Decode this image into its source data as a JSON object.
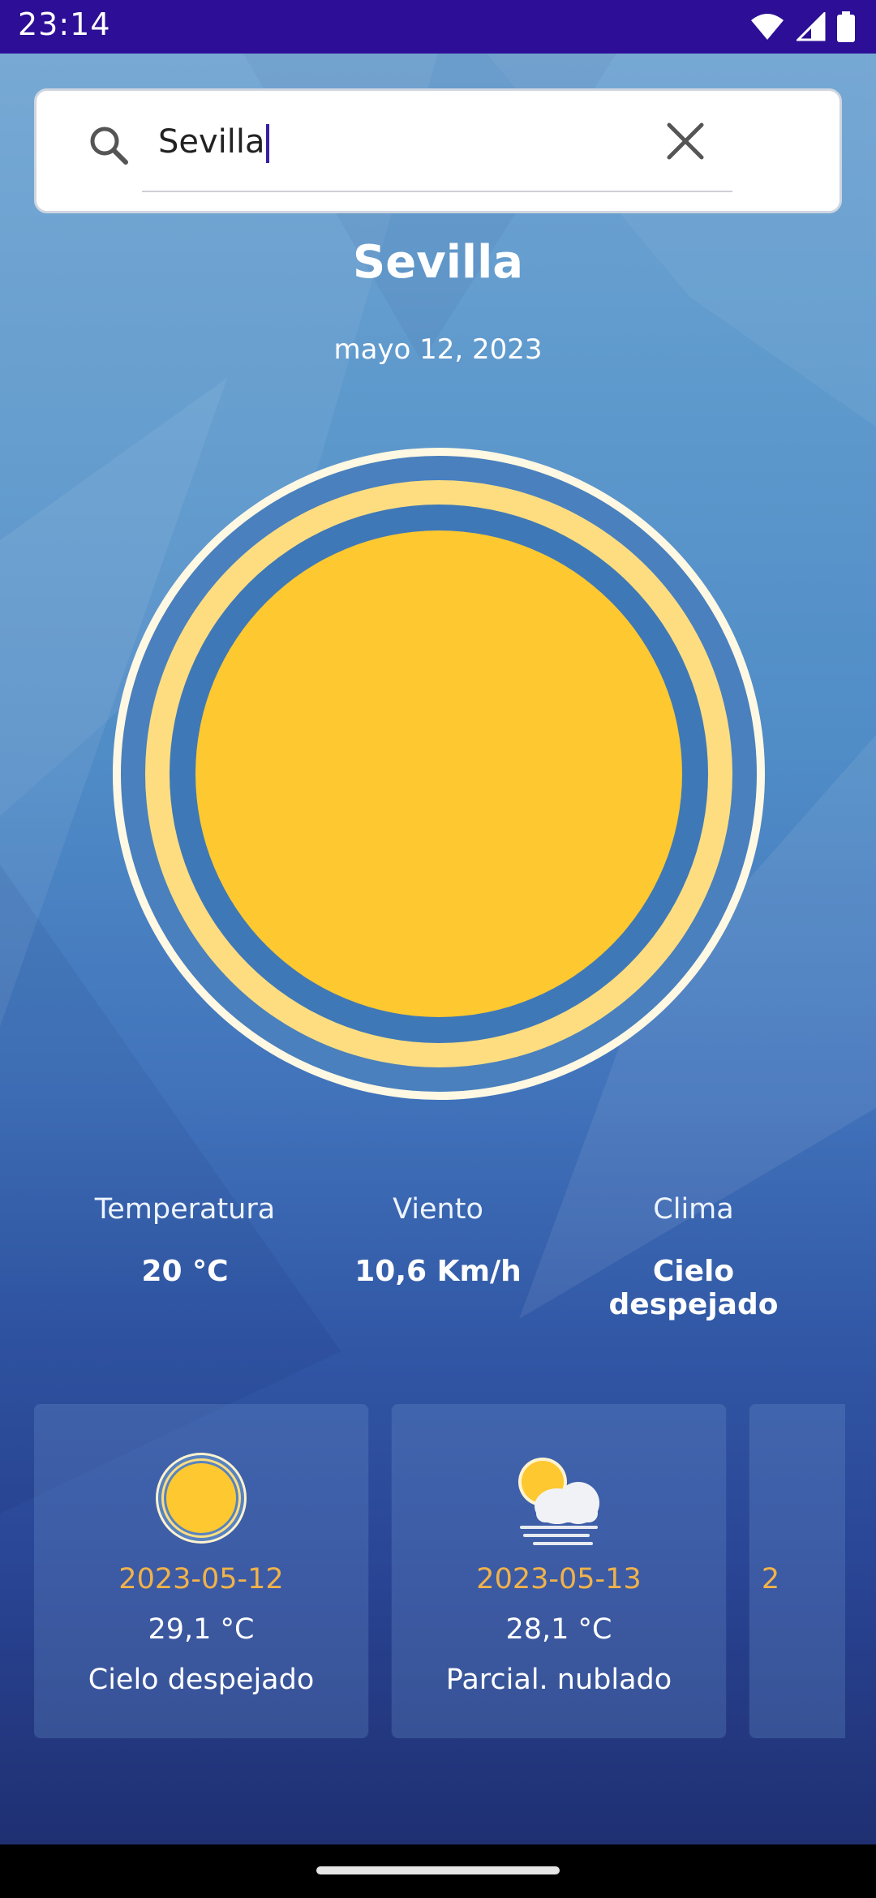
{
  "status_bar": {
    "time": "23:14"
  },
  "search": {
    "value": "Sevilla"
  },
  "location": {
    "city": "Sevilla",
    "date": "mayo 12, 2023"
  },
  "current": {
    "temperature": {
      "label": "Temperatura",
      "value": "20 °C"
    },
    "wind": {
      "label": "Viento",
      "value": "10,6 Km/h"
    },
    "weather": {
      "label": "Clima",
      "value": "Cielo despejado"
    },
    "icon": "sun-icon"
  },
  "forecast": [
    {
      "date": "2023-05-12",
      "temp": "29,1 °C",
      "desc": "Cielo despejado",
      "icon": "sun-icon"
    },
    {
      "date": "2023-05-13",
      "temp": "28,1 °C",
      "desc": "Parcial. nublado",
      "icon": "partly-cloudy-icon"
    },
    {
      "date": "2",
      "temp": "",
      "desc": "",
      "icon": ""
    }
  ],
  "colors": {
    "status_bar": "#2c0f96",
    "sun": "#fdc830",
    "forecast_date": "#f1b24a"
  }
}
